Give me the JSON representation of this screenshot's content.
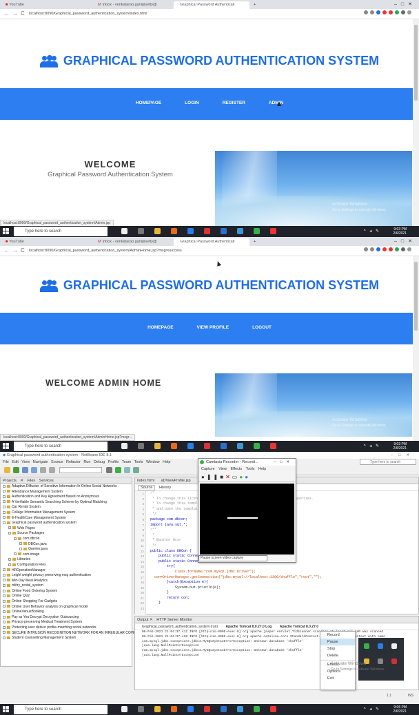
{
  "colors": {
    "site_blue": "#1e6ee8",
    "navbar": "#2d7ef0",
    "taskbar": "#1f2329",
    "tab_bar": "#dee1e6"
  },
  "screen1": {
    "tabs": [
      {
        "label": "YouTube",
        "icon": "youtube-icon"
      },
      {
        "label": "Inbox - venkatarao.ganipisetty@",
        "icon": "gmail-icon"
      },
      {
        "label": "Graphical Password Authenticati",
        "icon": "page-icon"
      }
    ],
    "url": "localhost:8090/Graphical_password_authentication_system/index.html",
    "site_title": "GRAPHICAL PASSWORD AUTHENTICATION SYSTEM",
    "nav": [
      "HOMEPAGE",
      "LOGIN",
      "REGISTER",
      "ADMIN"
    ],
    "welcome": "WELCOME",
    "subtitle": "Graphical Password Authentication System",
    "activate_title": "Activate Windows",
    "activate_sub": "Go to Settings to activate Windows.",
    "status_url": "localhost:8090/Graphical_password_authentication_system/Admin.jsp",
    "search_placeholder": "Type here to search",
    "time": "9:03 PM",
    "date": "2/6/2021"
  },
  "screen2": {
    "tabs": [
      {
        "label": "YouTube",
        "icon": "youtube-icon"
      },
      {
        "label": "Inbox - venkatarao.ganipisetty@",
        "icon": "gmail-icon"
      },
      {
        "label": "Graphical Password Authenticati",
        "icon": "page-icon"
      }
    ],
    "url": "localhost:8090/Graphical_password_authentication_system/AdminHome.jsp?msg=success",
    "site_title": "GRAPHICAL PASSWORD AUTHENTICATION SYSTEM",
    "nav": [
      "HOMEPAGE",
      "VIEW PROFILE",
      "LOGOUT"
    ],
    "welcome": "WELCOME ADMIN HOME",
    "activate_title": "Activate Windows",
    "activate_sub": "Go to Settings to activate Windows.",
    "status_url": "localhost:8090/Graphical_password_authentication_system/AdminHome.jsp?msgr...",
    "search_placeholder": "Type here to search",
    "time": "9:03 PM",
    "date": "2/6/2021"
  },
  "screen3": {
    "title": "Graphical password authentication system - NetBeans IDE 8.1",
    "menu": [
      "File",
      "Edit",
      "View",
      "Navigate",
      "Source",
      "Refactor",
      "Run",
      "Debug",
      "Profile",
      "Team",
      "Tools",
      "Window",
      "Help"
    ],
    "search_placeholder": "Type here to search",
    "project_tabs": [
      "Projects",
      "Files",
      "Services"
    ],
    "projects": [
      "Adaptive Diffusion of Sensitive Information In Online Social Networks",
      "Attendance Management System",
      "Authentication and Key Agreement Based on Anonymous",
      "A Verifiable Semantic Searching Scheme by Optimal Matching",
      "Car Rental System",
      "College Information Management System",
      "E-HealthCare Management System",
      "Graphical password authentication system",
      "Web Pages",
      "Source Packages",
      "com.dbcon",
      "DBCon.java",
      "Queries.java",
      "com.image",
      "Libraries",
      "Configuration Files",
      "HROperationManager",
      "Leight weight privacy preserving msg authentication",
      "Mid-Day Meal Analytics",
      "mlitry_rental_system",
      "Online Food Ordering System",
      "Online Quiz",
      "Online Shopping For Gadgets",
      "Online User Behavior analysis on graphical model",
      "OnlineVenueBooking",
      "Pay as You Decrypt Decryption Outsourcing",
      "Privacy-preserving Medical Treatment System",
      "Protecting user data in profile-matching social networks",
      "SECURE INTRUSION RECOGNITION NETWORK FOR AN IRREGULAR COVER",
      "Student Counselling Management System"
    ],
    "editor_tabs": [
      "index.html",
      "aDViewProfile.jsp"
    ],
    "editor_modes": [
      "Source",
      "History"
    ],
    "line_numbers": [
      "1",
      "2",
      "3",
      "4",
      "5",
      "6",
      "7",
      "8",
      "9",
      "10",
      "11",
      "12",
      "13",
      "14",
      "15",
      "16",
      "17",
      "18",
      "19",
      "20",
      "21",
      "22",
      "23"
    ],
    "code": [
      "/*",
      " * To change this license header, choose License Headers in Project Properties.",
      " * To change this template file, choose Tools | Templates",
      " * and open the template in the editor.",
      " */",
      "package com.dbcon;",
      "import java.sql.*;",
      "/**",
      " *",
      " * @author Ncsr",
      " */",
      "public class DBCon {",
      "    public static Connection con;",
      "    public static Connection getConnection(){",
      "        try{",
      "            Class.forName(\"com.mysql.jdbc.Driver\");",
      "  con=DriverManager.getConnection(\"jdbc:mysql://localhost:3306/shuffle\",\"root\",\"\");",
      "",
      "        }catch(Exception e){",
      "            System.out.println(e);",
      "        }",
      "        return con;",
      "    }"
    ],
    "camtasia": {
      "title": "Camtasia Recorder - Recordi...",
      "menu": [
        "Capture",
        "View",
        "Effects",
        "Tools",
        "Help"
      ],
      "tooltip": "Pause screen video capture"
    },
    "output_tabs": [
      "Output",
      "HTTP Server Monitor"
    ],
    "output_subtabs": [
      "Graphical_password_authentication_system (run)",
      "Apache Tomcat 8.0.27.0 Log",
      "Apache Tomcat 8.0.27.0"
    ],
    "logs": [
      "06-Feb-2021 21:04:37.412 INFO [http-nio-8090-exec-8] org.apache.jasper.servlet.TldScanner.scanJars At least one JAR was scanned",
      "06-Feb-2021 21:04:37.430 INFO [http-nio-8090-exec-8] org.apache.catalina.core.StandardContext.reload Reloading Context with name",
      "com.mysql.jdbc.exceptions.jdbc4.MySQLSyntaxErrorException: Unknown database 'shuffle'",
      "java.lang.NullPointerException",
      "com.mysql.jdbc.exceptions.jdbc4.MySQLSyntaxErrorException: Unknown database 'shuffle'",
      "java.lang.NullPointerException"
    ],
    "context_menu": [
      "Record",
      "Pause",
      "Stop",
      "Delete",
      "Effects",
      "Options",
      "Exit"
    ],
    "activate_title": "Activate Windows",
    "activate_sub": "Go to Settings to activate Windows.",
    "position": "1:1",
    "ins": "INS",
    "time": "9:06 PM",
    "date": "2/6/2021"
  }
}
